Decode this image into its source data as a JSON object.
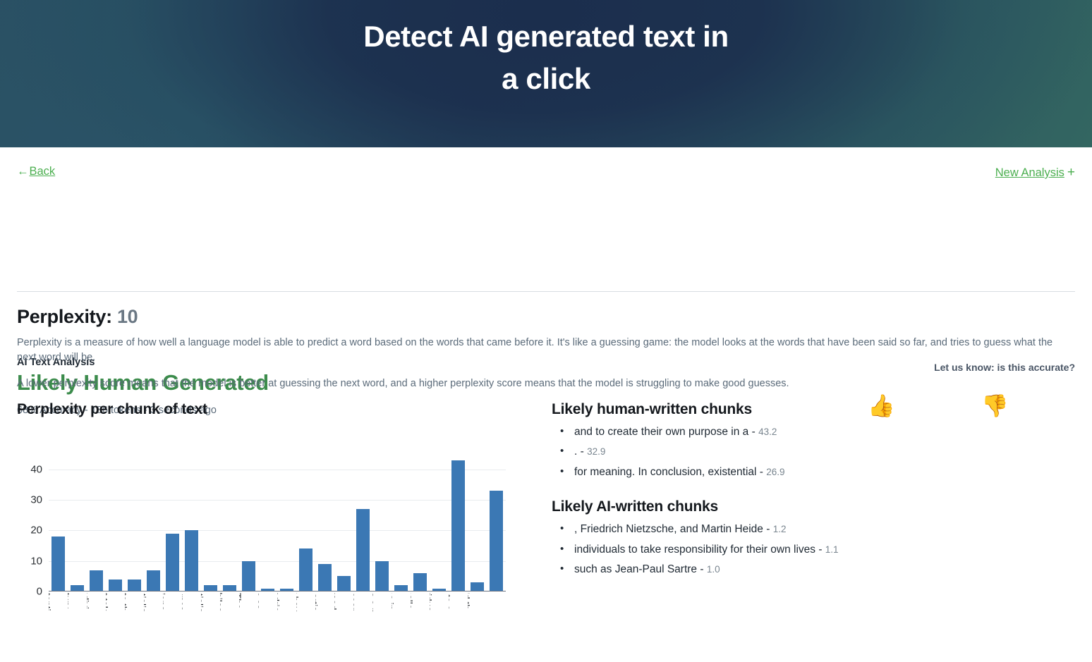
{
  "hero": {
    "title_line1": "Detect AI generated text in",
    "title_line2": "a click"
  },
  "nav": {
    "back_arrow": "←",
    "back_label": "Back",
    "new_analysis_label": "New Analysis",
    "new_analysis_plus": "+"
  },
  "result": {
    "kicker": "AI Text Analysis",
    "verdict": "Likely Human Generated",
    "verdict_color": "#3c8c4c",
    "meta": "68% Accuracy - 186 tokens - 3 seconds ago"
  },
  "feedback": {
    "question": "Let us know: is this accurate?",
    "thumbs_up": "👍",
    "thumbs_down": "👎"
  },
  "perplexity": {
    "label": "Perplexity: ",
    "value": "10",
    "paragraph1": "Perplexity is a measure of how well a language model is able to predict a word based on the words that came before it. It's like a guessing game: the model looks at the words that have been said so far, and tries to guess what the next word will be.",
    "paragraph2": "A lower perplexity score means that the model is better at guessing the next word, and a higher perplexity score means that the model is struggling to make good guesses."
  },
  "chart_data": {
    "type": "bar",
    "title": "Perplexity per chunk of text",
    "xlabel": "",
    "ylabel": "",
    "ylim": [
      0,
      45
    ],
    "yticks": [
      0,
      10,
      20,
      30,
      40
    ],
    "grid": true,
    "legend": "none",
    "bar_color": "#3b78b4",
    "categories": [
      "Existenti",
      "century",
      "of indivi",
      "must tak",
      "create th",
      "istentialis",
      "of aliena",
      "the unce",
      "istentialis",
      "on philos",
      "art. The",
      "such as",
      ", Friedric",
      "gger hav",
      "and artis",
      "as freed",
      "for mear",
      "ism is a p",
      "of the in",
      "It challe",
      "individua",
      "and to c",
      "world th",
      "."
    ],
    "values": [
      18,
      2,
      7,
      4,
      4,
      7,
      19,
      20,
      2,
      2,
      10,
      1,
      1,
      14,
      9,
      5,
      27,
      10,
      2,
      6,
      1,
      43,
      3,
      33
    ]
  },
  "human_chunks": {
    "heading": "Likely human-written chunks",
    "items": [
      {
        "text": "and to create their own purpose in a - ",
        "score": "43.2"
      },
      {
        "text": ". - ",
        "score": "32.9"
      },
      {
        "text": "for meaning. In conclusion, existential - ",
        "score": "26.9"
      }
    ]
  },
  "ai_chunks": {
    "heading": "Likely AI-written chunks",
    "items": [
      {
        "text": ", Friedrich Nietzsche, and Martin Heide - ",
        "score": "1.2"
      },
      {
        "text": "individuals to take responsibility for their own lives - ",
        "score": "1.1"
      },
      {
        "text": "such as Jean-Paul Sartre - ",
        "score": "1.0"
      }
    ]
  }
}
